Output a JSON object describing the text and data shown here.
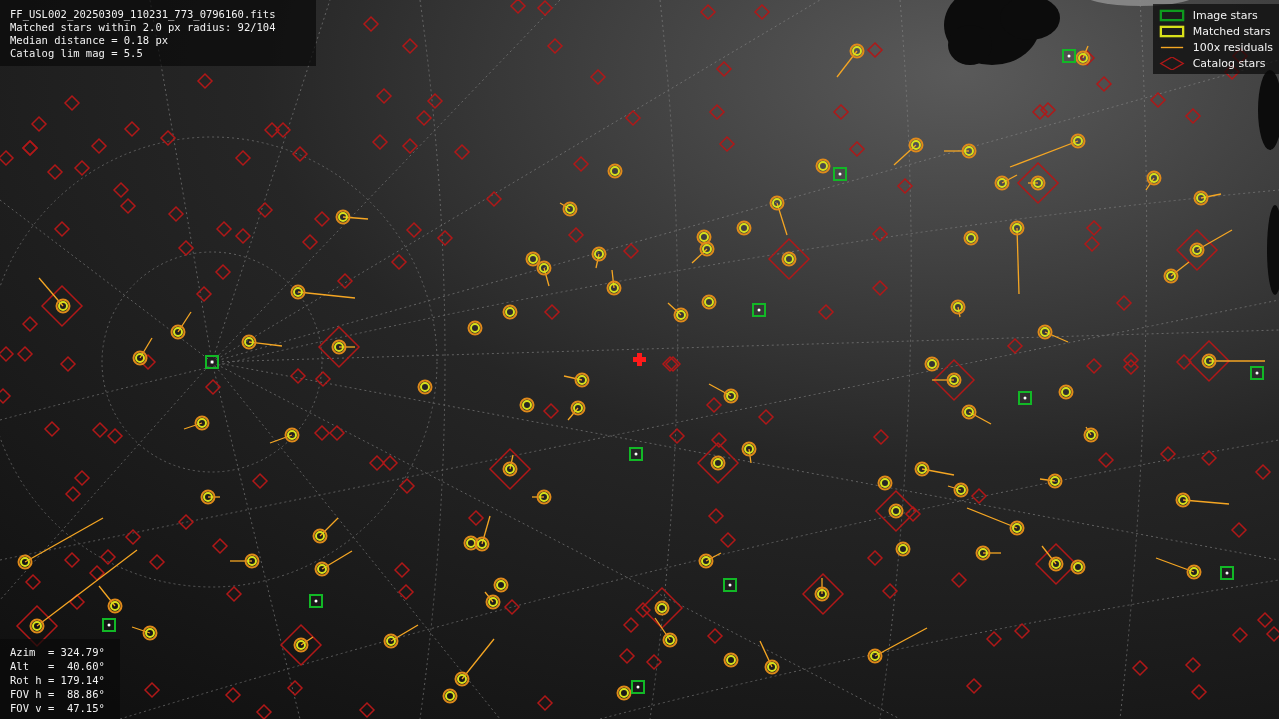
{
  "info": [
    "FF_USL002_20250309_110231_773_0796160.fits",
    "Matched stars within 2.0 px radius: 92/104",
    "Median distance = 0.18 px",
    "Catalog lim mag = 5.5"
  ],
  "legend": [
    {
      "label": "Image stars"
    },
    {
      "kind": "matched",
      "label": "Matched stars"
    },
    {
      "kind": "residual",
      "label": "100x residuals"
    },
    {
      "kind": "catalog",
      "label": "Catalog stars"
    }
  ],
  "pointing": [
    "Azim  = 324.79°",
    "Alt   =  40.60°",
    "Rot h = 179.14°",
    "FOV h =  88.86°",
    "FOV v =  47.15°"
  ]
}
